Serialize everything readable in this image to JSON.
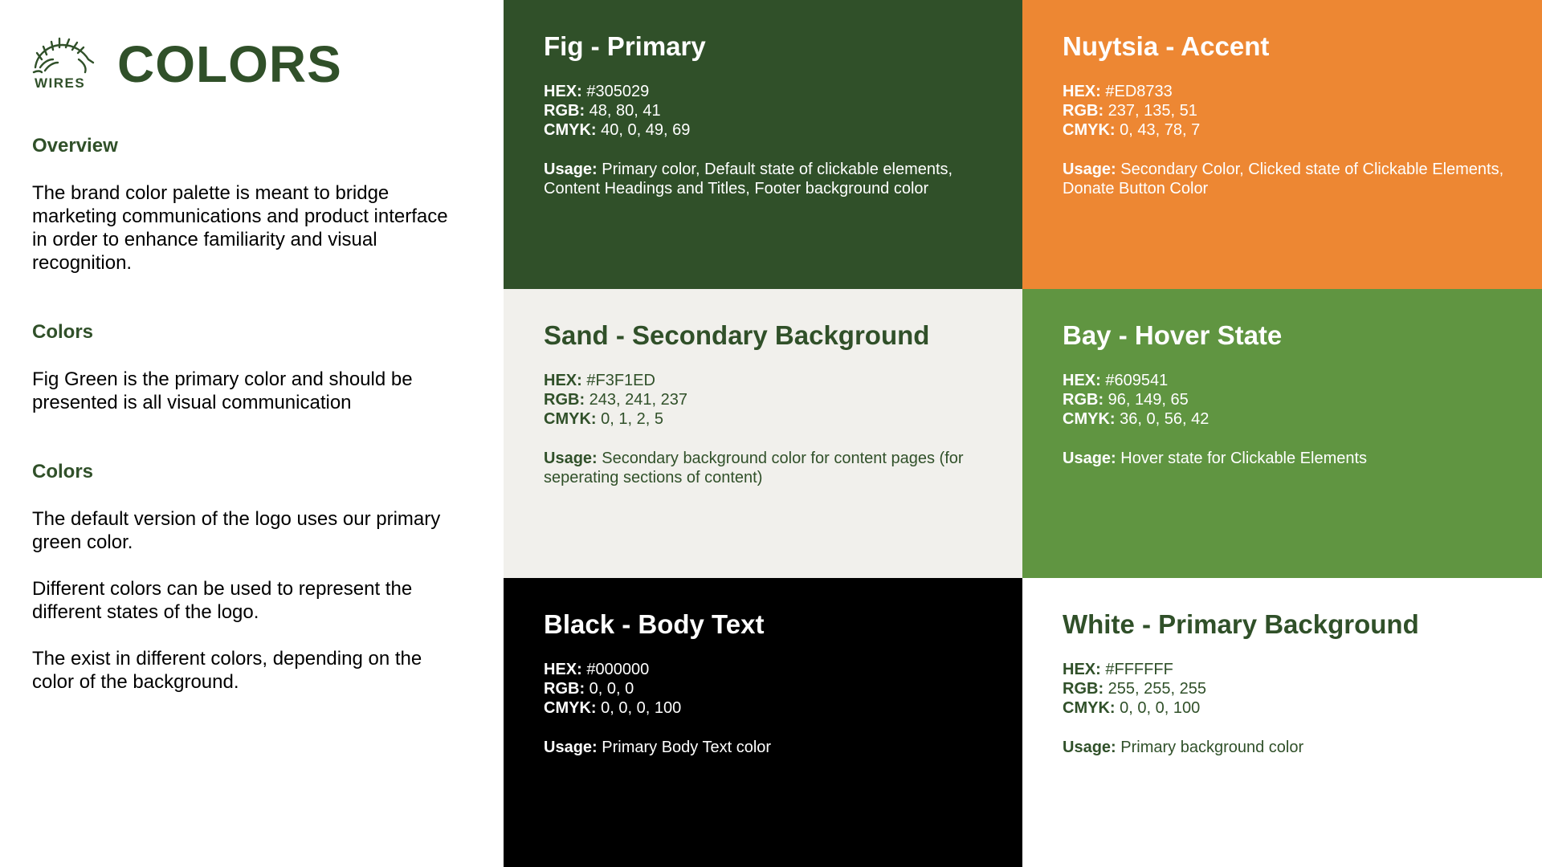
{
  "brand": {
    "logo_text": "WIRES",
    "logo_icon": "echidna-logo-icon",
    "title": "COLORS"
  },
  "sections": [
    {
      "heading": "Overview",
      "paragraphs": [
        "The brand color palette is meant to bridge marketing communications and product interface in order to enhance familiarity and visual recognition."
      ]
    },
    {
      "heading": "Colors",
      "paragraphs": [
        "Fig Green is the primary color and should be presented is all visual communication"
      ]
    },
    {
      "heading": "Colors",
      "paragraphs": [
        "The default version of the logo uses our primary green color.",
        "Different colors can be used to represent the different states of the logo.",
        "The exist in different colors, depending on the color of the background."
      ]
    }
  ],
  "labels": {
    "hex": "HEX:",
    "rgb": "RGB:",
    "cmyk": "CMYK:",
    "usage": "Usage:"
  },
  "swatches": [
    {
      "name": "Fig - Primary",
      "hex": "#305029",
      "rgb": "48, 80, 41",
      "cmyk": "40, 0, 49, 69",
      "usage": "Primary color, Default state of clickable elements, Content Headings and Titles, Footer background color",
      "background": "#305029",
      "text_color": "#FFFFFF"
    },
    {
      "name": "Nuytsia - Accent",
      "hex": "#ED8733",
      "rgb": "237, 135, 51",
      "cmyk": "0, 43, 78, 7",
      "usage": "Secondary Color, Clicked state of Clickable Elements, Donate Button Color",
      "background": "#ED8733",
      "text_color": "#FFFFFF"
    },
    {
      "name": "Sand - Secondary Background",
      "hex": "#F3F1ED",
      "rgb": "243, 241, 237",
      "cmyk": "0, 1, 2, 5",
      "usage": "Secondary background color for content pages (for seperating sections of content)",
      "background": "#F1F0EC",
      "text_color": "#305029"
    },
    {
      "name": "Bay - Hover State",
      "hex": "#609541",
      "rgb": "96, 149, 65",
      "cmyk": "36, 0, 56, 42",
      "usage": "Hover state for Clickable Elements",
      "background": "#609541",
      "text_color": "#FFFFFF"
    },
    {
      "name": "Black - Body Text",
      "hex": "#000000",
      "rgb": "0, 0, 0",
      "cmyk": "0, 0, 0, 100",
      "usage": "Primary Body Text color",
      "background": "#000000",
      "text_color": "#FFFFFF"
    },
    {
      "name": "White - Primary Background",
      "hex": "#FFFFFF",
      "rgb": "255, 255, 255",
      "cmyk": "0, 0, 0, 100",
      "usage": "Primary background color",
      "background": "#FFFFFF",
      "text_color": "#305029"
    }
  ]
}
